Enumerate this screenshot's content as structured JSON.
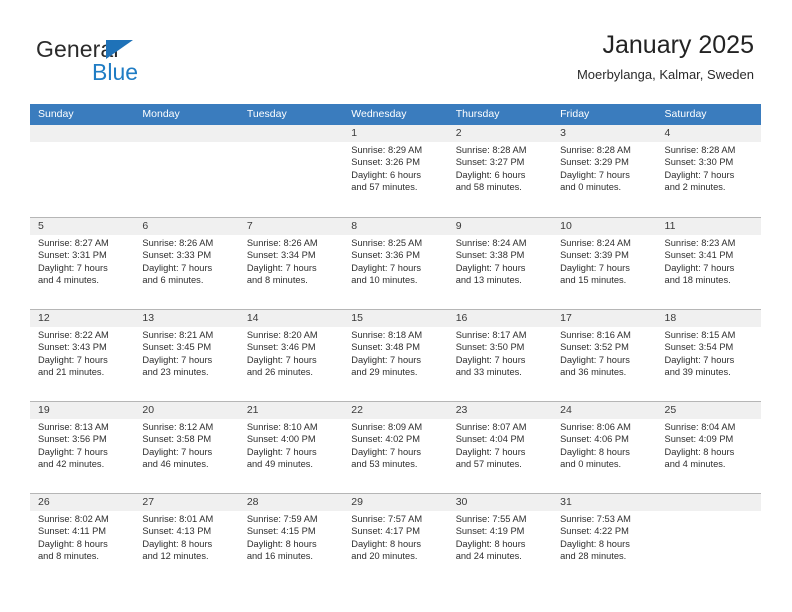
{
  "brand": {
    "name_top": "General",
    "name_bottom": "Blue",
    "color_blue": "#1f7cc4",
    "triangle_color": "#1f72b8"
  },
  "header": {
    "title": "January 2025",
    "subtitle": "Moerbylanga, Kalmar, Sweden"
  },
  "colors": {
    "header_bar": "#3a7cbe",
    "daynum_band": "#f0f0f0",
    "row_divider": "#b6b6b6",
    "text": "#2e2e2e"
  },
  "weekdays": [
    "Sunday",
    "Monday",
    "Tuesday",
    "Wednesday",
    "Thursday",
    "Friday",
    "Saturday"
  ],
  "weeks": [
    [
      {
        "day": "",
        "lines": []
      },
      {
        "day": "",
        "lines": []
      },
      {
        "day": "",
        "lines": []
      },
      {
        "day": "1",
        "lines": [
          "Sunrise: 8:29 AM",
          "Sunset: 3:26 PM",
          "Daylight: 6 hours",
          "and 57 minutes."
        ]
      },
      {
        "day": "2",
        "lines": [
          "Sunrise: 8:28 AM",
          "Sunset: 3:27 PM",
          "Daylight: 6 hours",
          "and 58 minutes."
        ]
      },
      {
        "day": "3",
        "lines": [
          "Sunrise: 8:28 AM",
          "Sunset: 3:29 PM",
          "Daylight: 7 hours",
          "and 0 minutes."
        ]
      },
      {
        "day": "4",
        "lines": [
          "Sunrise: 8:28 AM",
          "Sunset: 3:30 PM",
          "Daylight: 7 hours",
          "and 2 minutes."
        ]
      }
    ],
    [
      {
        "day": "5",
        "lines": [
          "Sunrise: 8:27 AM",
          "Sunset: 3:31 PM",
          "Daylight: 7 hours",
          "and 4 minutes."
        ]
      },
      {
        "day": "6",
        "lines": [
          "Sunrise: 8:26 AM",
          "Sunset: 3:33 PM",
          "Daylight: 7 hours",
          "and 6 minutes."
        ]
      },
      {
        "day": "7",
        "lines": [
          "Sunrise: 8:26 AM",
          "Sunset: 3:34 PM",
          "Daylight: 7 hours",
          "and 8 minutes."
        ]
      },
      {
        "day": "8",
        "lines": [
          "Sunrise: 8:25 AM",
          "Sunset: 3:36 PM",
          "Daylight: 7 hours",
          "and 10 minutes."
        ]
      },
      {
        "day": "9",
        "lines": [
          "Sunrise: 8:24 AM",
          "Sunset: 3:38 PM",
          "Daylight: 7 hours",
          "and 13 minutes."
        ]
      },
      {
        "day": "10",
        "lines": [
          "Sunrise: 8:24 AM",
          "Sunset: 3:39 PM",
          "Daylight: 7 hours",
          "and 15 minutes."
        ]
      },
      {
        "day": "11",
        "lines": [
          "Sunrise: 8:23 AM",
          "Sunset: 3:41 PM",
          "Daylight: 7 hours",
          "and 18 minutes."
        ]
      }
    ],
    [
      {
        "day": "12",
        "lines": [
          "Sunrise: 8:22 AM",
          "Sunset: 3:43 PM",
          "Daylight: 7 hours",
          "and 21 minutes."
        ]
      },
      {
        "day": "13",
        "lines": [
          "Sunrise: 8:21 AM",
          "Sunset: 3:45 PM",
          "Daylight: 7 hours",
          "and 23 minutes."
        ]
      },
      {
        "day": "14",
        "lines": [
          "Sunrise: 8:20 AM",
          "Sunset: 3:46 PM",
          "Daylight: 7 hours",
          "and 26 minutes."
        ]
      },
      {
        "day": "15",
        "lines": [
          "Sunrise: 8:18 AM",
          "Sunset: 3:48 PM",
          "Daylight: 7 hours",
          "and 29 minutes."
        ]
      },
      {
        "day": "16",
        "lines": [
          "Sunrise: 8:17 AM",
          "Sunset: 3:50 PM",
          "Daylight: 7 hours",
          "and 33 minutes."
        ]
      },
      {
        "day": "17",
        "lines": [
          "Sunrise: 8:16 AM",
          "Sunset: 3:52 PM",
          "Daylight: 7 hours",
          "and 36 minutes."
        ]
      },
      {
        "day": "18",
        "lines": [
          "Sunrise: 8:15 AM",
          "Sunset: 3:54 PM",
          "Daylight: 7 hours",
          "and 39 minutes."
        ]
      }
    ],
    [
      {
        "day": "19",
        "lines": [
          "Sunrise: 8:13 AM",
          "Sunset: 3:56 PM",
          "Daylight: 7 hours",
          "and 42 minutes."
        ]
      },
      {
        "day": "20",
        "lines": [
          "Sunrise: 8:12 AM",
          "Sunset: 3:58 PM",
          "Daylight: 7 hours",
          "and 46 minutes."
        ]
      },
      {
        "day": "21",
        "lines": [
          "Sunrise: 8:10 AM",
          "Sunset: 4:00 PM",
          "Daylight: 7 hours",
          "and 49 minutes."
        ]
      },
      {
        "day": "22",
        "lines": [
          "Sunrise: 8:09 AM",
          "Sunset: 4:02 PM",
          "Daylight: 7 hours",
          "and 53 minutes."
        ]
      },
      {
        "day": "23",
        "lines": [
          "Sunrise: 8:07 AM",
          "Sunset: 4:04 PM",
          "Daylight: 7 hours",
          "and 57 minutes."
        ]
      },
      {
        "day": "24",
        "lines": [
          "Sunrise: 8:06 AM",
          "Sunset: 4:06 PM",
          "Daylight: 8 hours",
          "and 0 minutes."
        ]
      },
      {
        "day": "25",
        "lines": [
          "Sunrise: 8:04 AM",
          "Sunset: 4:09 PM",
          "Daylight: 8 hours",
          "and 4 minutes."
        ]
      }
    ],
    [
      {
        "day": "26",
        "lines": [
          "Sunrise: 8:02 AM",
          "Sunset: 4:11 PM",
          "Daylight: 8 hours",
          "and 8 minutes."
        ]
      },
      {
        "day": "27",
        "lines": [
          "Sunrise: 8:01 AM",
          "Sunset: 4:13 PM",
          "Daylight: 8 hours",
          "and 12 minutes."
        ]
      },
      {
        "day": "28",
        "lines": [
          "Sunrise: 7:59 AM",
          "Sunset: 4:15 PM",
          "Daylight: 8 hours",
          "and 16 minutes."
        ]
      },
      {
        "day": "29",
        "lines": [
          "Sunrise: 7:57 AM",
          "Sunset: 4:17 PM",
          "Daylight: 8 hours",
          "and 20 minutes."
        ]
      },
      {
        "day": "30",
        "lines": [
          "Sunrise: 7:55 AM",
          "Sunset: 4:19 PM",
          "Daylight: 8 hours",
          "and 24 minutes."
        ]
      },
      {
        "day": "31",
        "lines": [
          "Sunrise: 7:53 AM",
          "Sunset: 4:22 PM",
          "Daylight: 8 hours",
          "and 28 minutes."
        ]
      },
      {
        "day": "",
        "lines": []
      }
    ]
  ]
}
